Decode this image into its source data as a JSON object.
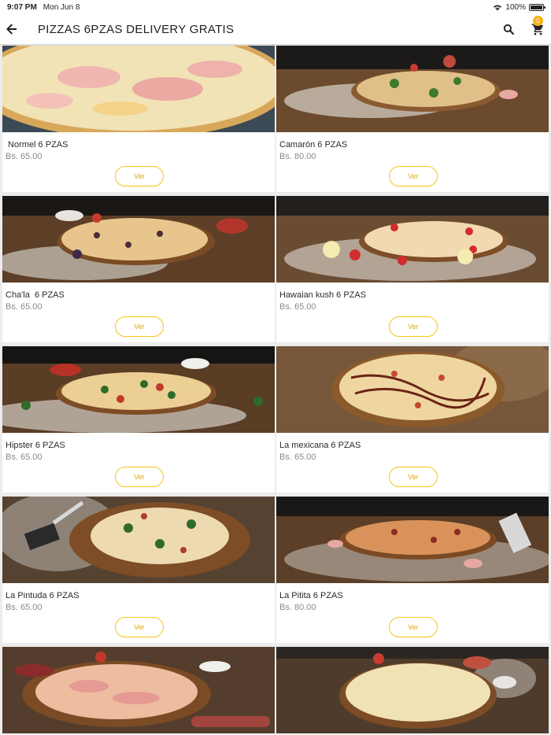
{
  "status_bar": {
    "time": "9:07 PM",
    "date": "Mon Jun 8",
    "battery": "100%"
  },
  "header": {
    "title": "PIZZAS 6PZAS DELIVERY GRATIS",
    "cart_count": "0"
  },
  "colors": {
    "accent": "#f5c518",
    "badge": "#f9b114"
  },
  "products": [
    {
      "name": " Normel 6 PZAS",
      "price": "Bs. 65.00",
      "button": "Ver"
    },
    {
      "name": "Camarón 6 PZAS",
      "price": "Bs. 80.00",
      "button": "Ver"
    },
    {
      "name": "Cha'la  6 PZAS",
      "price": "Bs. 65.00",
      "button": "Ver"
    },
    {
      "name": "Hawaian kush 6 PZAS",
      "price": "Bs. 65.00",
      "button": "Ver"
    },
    {
      "name": "Hipster 6 PZAS",
      "price": "Bs. 65.00",
      "button": "Ver"
    },
    {
      "name": "La mexicana 6 PZAS",
      "price": "Bs. 65.00",
      "button": "Ver"
    },
    {
      "name": "La Pintuda 6 PZAS",
      "price": "Bs. 65.00",
      "button": "Ver"
    },
    {
      "name": "La Pitita 6 PZAS",
      "price": "Bs. 80.00",
      "button": "Ver"
    }
  ]
}
